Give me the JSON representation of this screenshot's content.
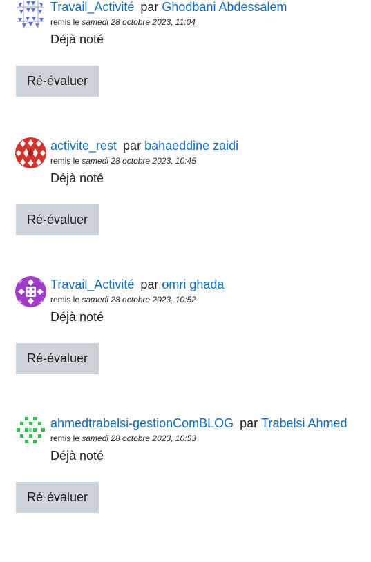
{
  "submissions": [
    {
      "title": "Travail_Activité",
      "by": "par",
      "author": "Ghodbani Abdessalem",
      "submitted_prefix": "remis le",
      "submitted_date": "samedi 28 octobre 2023, 11:04",
      "status": "Déjà noté",
      "button": "Ré-évaluer",
      "avatar_icon": "identicon-blue-geometric",
      "avatar_color": "#5b6fd6"
    },
    {
      "title": "activite_rest",
      "by": "par",
      "author": "bahaeddine zaidi",
      "submitted_prefix": "remis le",
      "submitted_date": "samedi 28 octobre 2023, 10:45",
      "status": "Déjà noté",
      "button": "Ré-évaluer",
      "avatar_icon": "identicon-red-diamonds",
      "avatar_color": "#d0342c"
    },
    {
      "title": "Travail_Activité",
      "by": "par",
      "author": "omri ghada",
      "submitted_prefix": "remis le",
      "submitted_date": "samedi 28 octobre 2023, 10:52",
      "status": "Déjà noté",
      "button": "Ré-évaluer",
      "avatar_icon": "identicon-purple-pattern",
      "avatar_color": "#a03cc6"
    },
    {
      "title": "ahmedtrabelsi-gestionComBLOG",
      "by": "par",
      "author": "Trabelsi Ahmed",
      "submitted_prefix": "remis le",
      "submitted_date": "samedi 28 octobre 2023, 10:53",
      "status": "Déjà noté",
      "button": "Ré-évaluer",
      "avatar_icon": "identicon-green-squares",
      "avatar_color": "#2fbf4a"
    }
  ],
  "colors": {
    "link": "#0f6cbf",
    "button_bg": "#ced4da",
    "text": "#1d2125"
  }
}
